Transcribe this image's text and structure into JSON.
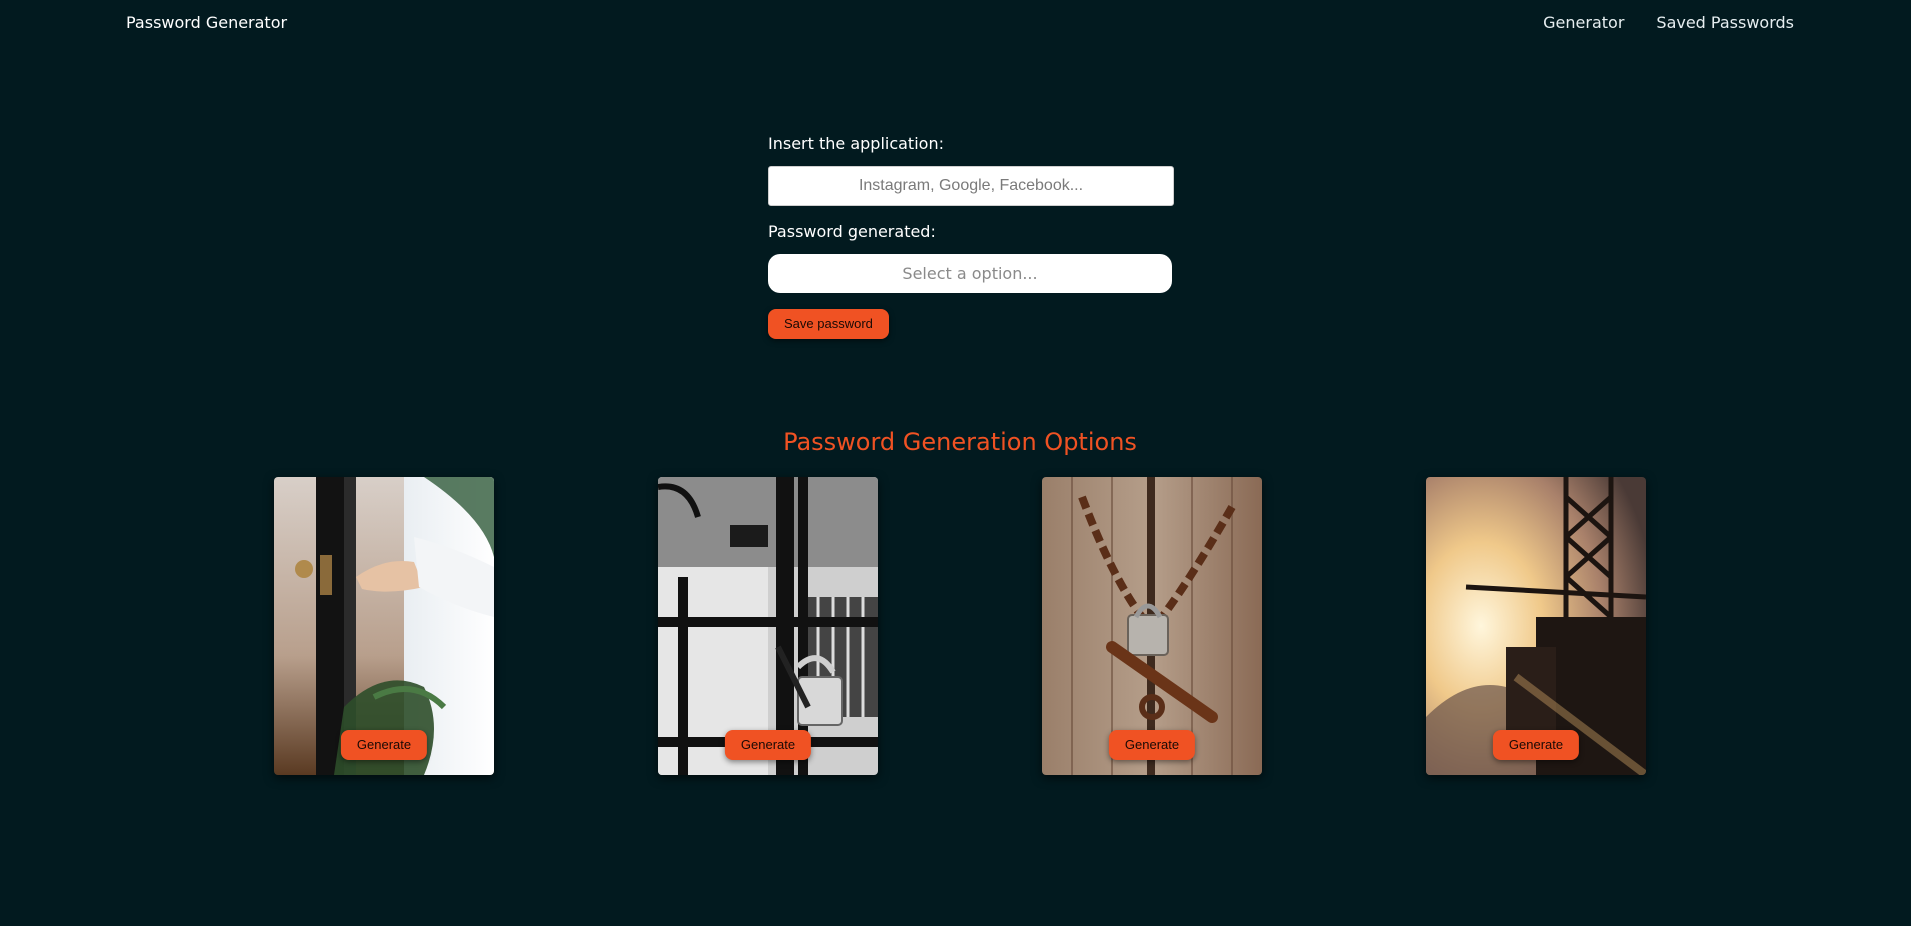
{
  "navbar": {
    "brand": "Password Generator",
    "links": [
      "Generator",
      "Saved Passwords"
    ]
  },
  "form": {
    "app_label": "Insert the application:",
    "app_placeholder": "Instagram, Google, Facebook...",
    "password_label": "Password generated:",
    "password_select_placeholder": "Select a option...",
    "save_label": "Save password"
  },
  "options": {
    "title": "Password Generation Options",
    "cards": [
      {
        "image": "hand-opening-door-photo",
        "button": "Generate"
      },
      {
        "image": "padlock-on-gate-bw-photo",
        "button": "Generate"
      },
      {
        "image": "chained-padlock-on-wooden-door-photo",
        "button": "Generate"
      },
      {
        "image": "industrial-crane-at-sunset-photo",
        "button": "Generate"
      }
    ]
  },
  "colors": {
    "background": "#021a1f",
    "accent": "#f05223",
    "text": "#ffffff"
  }
}
